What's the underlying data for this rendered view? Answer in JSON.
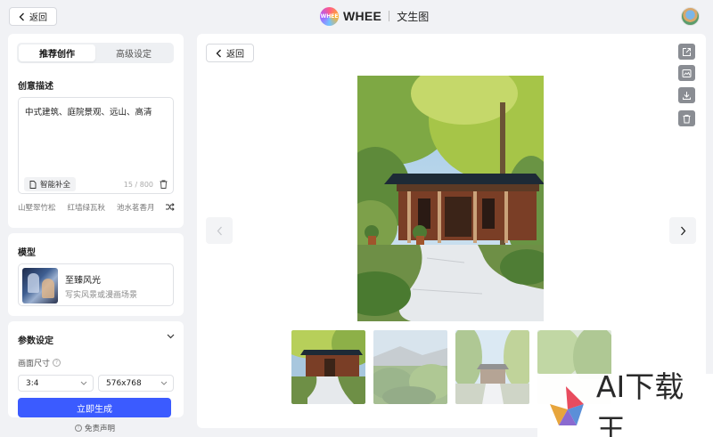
{
  "topbar": {
    "back_label": "返回",
    "brand_logo_text": "WHEE",
    "brand_name": "WHEE",
    "brand_sub": "文生图"
  },
  "left": {
    "tabs": [
      {
        "label": "推荐创作",
        "active": true
      },
      {
        "label": "高级设定",
        "active": false
      }
    ],
    "prompt_section_title": "创意描述",
    "prompt_text": "中式建筑、庭院景观、远山、高清",
    "smart_complete_label": "智能补全",
    "char_count": "15 / 800",
    "suggestions": [
      "山墅翠竹松",
      "红墙绿瓦秋",
      "池水茗香月"
    ],
    "model_section_title": "模型",
    "model": {
      "name": "至臻风光",
      "desc": "写实风景或漫画场景"
    },
    "params_section_title": "参数设定",
    "size_label": "画面尺寸",
    "ratio_value": "3:4",
    "resolution_value": "576x768",
    "generate_label": "立即生成",
    "disclaimer": "免责声明"
  },
  "main": {
    "back_label": "返回",
    "tools": [
      "external-link-icon",
      "image-compare-icon",
      "download-icon",
      "trash-icon"
    ],
    "thumbnails": [
      {
        "name": "thumb-1",
        "active": true
      },
      {
        "name": "thumb-2",
        "active": false
      },
      {
        "name": "thumb-3",
        "active": false
      },
      {
        "name": "thumb-4",
        "active": false
      }
    ]
  },
  "watermark": {
    "text": "AI下载王"
  },
  "colors": {
    "primary": "#3b5bff",
    "panel_bg": "#ffffff",
    "page_bg": "#f1f2f5"
  }
}
